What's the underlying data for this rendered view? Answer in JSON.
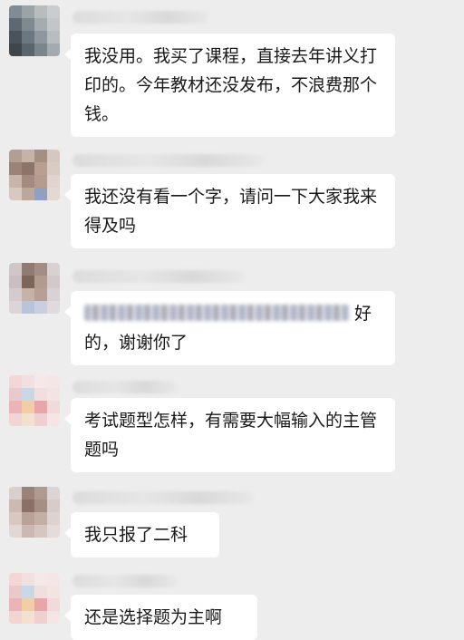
{
  "messages": [
    {
      "text": "我没用。我买了课程，直接去年讲义打印的。今年教材还没发布，不浪费那个钱。"
    },
    {
      "text": "我还没有看一个字，请问一下大家我来得及吗"
    },
    {
      "text_after_blur": "好的，谢谢你了"
    },
    {
      "text": "考试题型怎样，有需要大幅输入的主管题吗"
    },
    {
      "text": "我只报了二科"
    },
    {
      "text": "还是选择题为主啊"
    }
  ],
  "colors": {
    "background": "#ededed",
    "bubble": "#ffffff",
    "text": "#191919"
  }
}
